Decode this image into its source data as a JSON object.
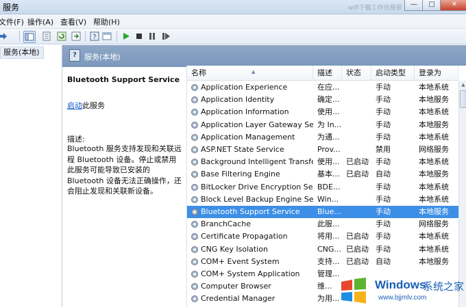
{
  "window": {
    "title": "服务",
    "title_extra": "wifi下载工作也是很",
    "buttons": [
      "minimize",
      "maximize",
      "close"
    ]
  },
  "menu": [
    "文件(F)",
    "操作(A)",
    "查看(V)",
    "帮助(H)"
  ],
  "toolbar": {
    "icons": [
      "back-arrow-icon",
      "forward-arrow-icon",
      "console-tree-icon",
      "export-list-icon",
      "refresh-icon",
      "help-icon",
      "properties-icon",
      "play-icon",
      "stop-icon",
      "pause-icon",
      "restart-icon"
    ]
  },
  "tree": {
    "selected": "服务(本地)"
  },
  "header": {
    "title": "服务(本地)"
  },
  "description": {
    "service_name": "Bluetooth Support Service",
    "start_link": "启动",
    "start_suffix": "此服务",
    "label": "描述:",
    "text": "Bluetooth 服务支持发现和关联远程 Bluetooth 设备。停止或禁用此服务可能导致已安装的 Bluetooth 设备无法正确操作，还会阻止发现和关联新设备。"
  },
  "columns": [
    "名称",
    "描述",
    "状态",
    "启动类型",
    "登录为"
  ],
  "rows": [
    [
      "Application Experience",
      "在应...",
      "",
      "手动",
      "本地系统"
    ],
    [
      "Application Identity",
      "确定...",
      "",
      "手动",
      "本地服务"
    ],
    [
      "Application Information",
      "使用...",
      "",
      "手动",
      "本地系统"
    ],
    [
      "Application Layer Gateway Ser...",
      "为 In...",
      "",
      "手动",
      "本地服务"
    ],
    [
      "Application Management",
      "为通...",
      "",
      "手动",
      "本地系统"
    ],
    [
      "ASP.NET State Service",
      "Prov...",
      "",
      "禁用",
      "网络服务"
    ],
    [
      "Background Intelligent Transfe...",
      "使用...",
      "已启动",
      "手动",
      "本地系统"
    ],
    [
      "Base Filtering Engine",
      "基本...",
      "已启动",
      "自动",
      "本地服务"
    ],
    [
      "BitLocker Drive Encryption Ser...",
      "BDE...",
      "",
      "手动",
      "本地系统"
    ],
    [
      "Block Level Backup Engine Ser...",
      "Win...",
      "",
      "手动",
      "本地系统"
    ],
    [
      "Bluetooth Support Service",
      "Blue...",
      "",
      "手动",
      "本地服务"
    ],
    [
      "BranchCache",
      "此服...",
      "",
      "手动",
      "网络服务"
    ],
    [
      "Certificate Propagation",
      "将用...",
      "已启动",
      "手动",
      "本地系统"
    ],
    [
      "CNG Key Isolation",
      "CNG...",
      "已启动",
      "手动",
      "本地系统"
    ],
    [
      "COM+ Event System",
      "支持...",
      "已启动",
      "自动",
      "本地服务"
    ],
    [
      "COM+ System Application",
      "管理...",
      "",
      "",
      ""
    ],
    [
      "Computer Browser",
      "维...",
      "",
      "",
      ""
    ],
    [
      "Credential Manager",
      "为用...",
      "",
      "",
      ""
    ]
  ],
  "selected_row": 10,
  "watermark": {
    "brand": "Windows",
    "cn": "系统之家",
    "url": "www.bjjmlv.com"
  },
  "colors": {
    "selection": "#3d8ee6",
    "header_band": "#7b98bc",
    "link": "#0b54c8"
  }
}
